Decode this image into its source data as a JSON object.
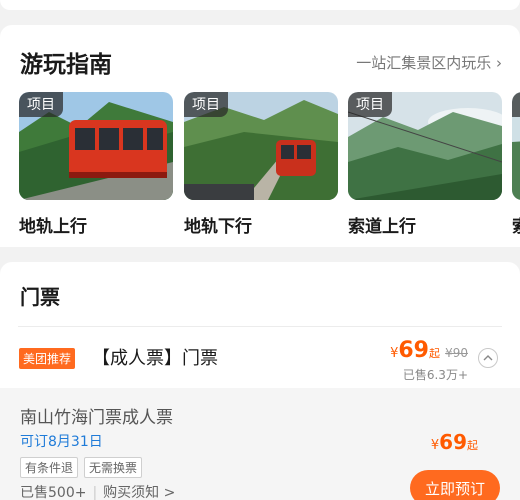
{
  "guide": {
    "title": "游玩指南",
    "more": "一站汇集景区内玩乐 ›",
    "items": [
      {
        "tag": "项目",
        "name": "地轨上行"
      },
      {
        "tag": "项目",
        "name": "地轨下行"
      },
      {
        "tag": "项目",
        "name": "索道上行"
      },
      {
        "tag": "项目",
        "name": "索"
      }
    ]
  },
  "tickets": {
    "title": "门票",
    "row": {
      "badge": "美团推荐",
      "title": "【成人票】门票",
      "currency": "¥",
      "price": "69",
      "from": "起",
      "original": "¥90",
      "sold": "已售6.3万+"
    },
    "sub": {
      "title": "南山竹海门票成人票",
      "date": "可订8月31日",
      "tags": [
        "有条件退",
        "无需换票"
      ],
      "sold": "已售500+",
      "divider": "|",
      "notice": "购买须知 >",
      "currency": "¥",
      "price": "69",
      "from": "起",
      "book": "立即预订"
    }
  },
  "colors": {
    "accent": "#ff6a1f",
    "price": "#ff5a00",
    "link_blue": "#1f7bd8"
  }
}
